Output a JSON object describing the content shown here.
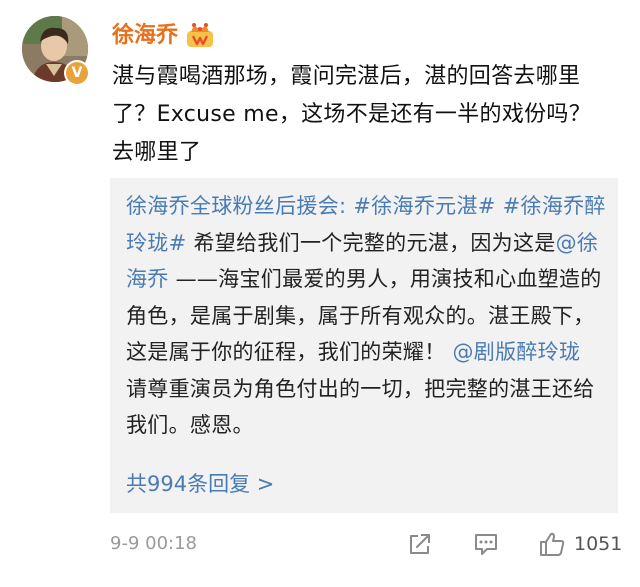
{
  "post": {
    "author": "徐海乔",
    "text": "湛与霞喝酒那场，霞问完湛后，湛的回答去哪里了？Excuse me，这场不是还有一半的戏份吗？去哪里了",
    "timestamp": "9-9 00:18",
    "like_count": "1051"
  },
  "reply": {
    "author": "徐海乔全球粉丝后援会",
    "author_suffix": ": ",
    "hashtag_1": "#徐海乔元湛#",
    "hashtag_2": "#徐海乔醉玲珑#",
    "text_1": " 希望给我们一个完整的元湛，因为这是",
    "mention_1": "@徐海乔",
    "text_2": " ——海宝们最爱的男人，用演技和心血塑造的角色，是属于剧集，属于所有观众的。湛王殿下，这是属于你的征程，我们的荣耀！",
    "mention_2": "@剧版醉玲珑",
    "text_3": " 请尊重演员为角色付出的一切，把完整的湛王还给我们。感恩。",
    "count_label": "共994条回复 >"
  },
  "icons": {
    "avatar": "avatar-photo",
    "verified": "verified-badge-icon",
    "crown": "crown-vip-icon",
    "share": "share-icon",
    "comment": "comment-icon",
    "like": "thumbs-up-icon"
  },
  "colors": {
    "username": "#e8701a",
    "link": "#4a7bb3",
    "card_bg": "#f2f2f2",
    "verified_badge": "#e8a33a",
    "meta_text": "#9a9a9a"
  }
}
